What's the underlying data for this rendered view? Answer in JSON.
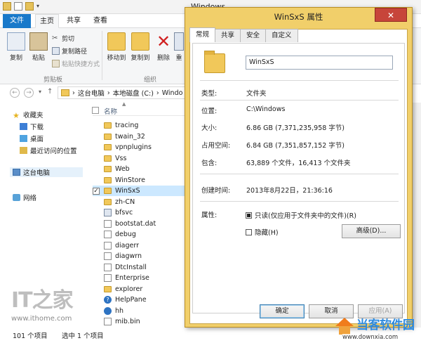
{
  "explorer": {
    "window_title": "Windows",
    "tabs": {
      "file": "文件",
      "home": "主页",
      "share": "共享",
      "view": "查看"
    },
    "ribbon": {
      "copy": "复制",
      "paste": "粘贴",
      "cut": "剪切",
      "copy_path": "复制路径",
      "paste_shortcut": "粘贴快捷方式",
      "clipboard_group": "剪贴板",
      "move_to": "移动到",
      "copy_to": "复制到",
      "delete": "删除",
      "rename": "重",
      "organize_group": "组织"
    },
    "address": {
      "parts": [
        "这台电脑",
        "本地磁盘 (C:)",
        "Windo"
      ],
      "sep": "›"
    },
    "nav": {
      "favorites": "收藏夹",
      "downloads": "下载",
      "desktop": "桌面",
      "recent": "最近访问的位置",
      "this_pc": "这台电脑",
      "network": "网络"
    },
    "column_name": "名称",
    "files": [
      {
        "name": "tracing",
        "type": "folder"
      },
      {
        "name": "twain_32",
        "type": "folder"
      },
      {
        "name": "vpnplugins",
        "type": "folder"
      },
      {
        "name": "Vss",
        "type": "folder"
      },
      {
        "name": "Web",
        "type": "folder"
      },
      {
        "name": "WinStore",
        "type": "folder"
      },
      {
        "name": "WinSxS",
        "type": "folder",
        "selected": true
      },
      {
        "name": "zh-CN",
        "type": "folder"
      },
      {
        "name": "bfsvc",
        "type": "exe"
      },
      {
        "name": "bootstat.dat",
        "type": "doc"
      },
      {
        "name": "debug",
        "type": "doc"
      },
      {
        "name": "diagerr",
        "type": "doc"
      },
      {
        "name": "diagwrn",
        "type": "doc"
      },
      {
        "name": "DtcInstall",
        "type": "doc"
      },
      {
        "name": "Enterprise",
        "type": "doc"
      },
      {
        "name": "explorer",
        "type": "folder"
      },
      {
        "name": "HelpPane",
        "type": "help"
      },
      {
        "name": "hh",
        "type": "hh"
      },
      {
        "name": "mib.bin",
        "type": "doc"
      }
    ],
    "status": {
      "count": "101 个项目",
      "selected": "选中 1 个项目"
    },
    "watermark": {
      "logo": "IT之家",
      "url": "www.ithome.com"
    }
  },
  "dialog": {
    "title": "WinSxS 属性",
    "close_glyph": "✕",
    "tabs": [
      "常规",
      "共享",
      "安全",
      "自定义"
    ],
    "name": "WinSxS",
    "rows": [
      {
        "key": "类型:",
        "value": "文件夹"
      },
      {
        "key": "位置:",
        "value": "C:\\Windows"
      },
      {
        "key": "大小:",
        "value": "6.86 GB (7,371,235,958 字节)"
      },
      {
        "key": "占用空间:",
        "value": "6.84 GB (7,351,857,152 字节)"
      },
      {
        "key": "包含:",
        "value": "63,889 个文件，16,413 个文件夹"
      },
      {
        "key": "创建时间:",
        "value": "2013年8月22日，21:36:16"
      },
      {
        "key": "属性:",
        "value": ""
      }
    ],
    "readonly_label": "只读(仅应用于文件夹中的文件)(R)",
    "readonly_checked": true,
    "hidden_label": "隐藏(H)",
    "hidden_checked": false,
    "advanced_button": "高级(D)...",
    "ok": "确定",
    "cancel": "取消",
    "apply": "应用(A)"
  },
  "corner_watermark": {
    "brand": "当客软件园",
    "site": "www.downxia.com"
  }
}
